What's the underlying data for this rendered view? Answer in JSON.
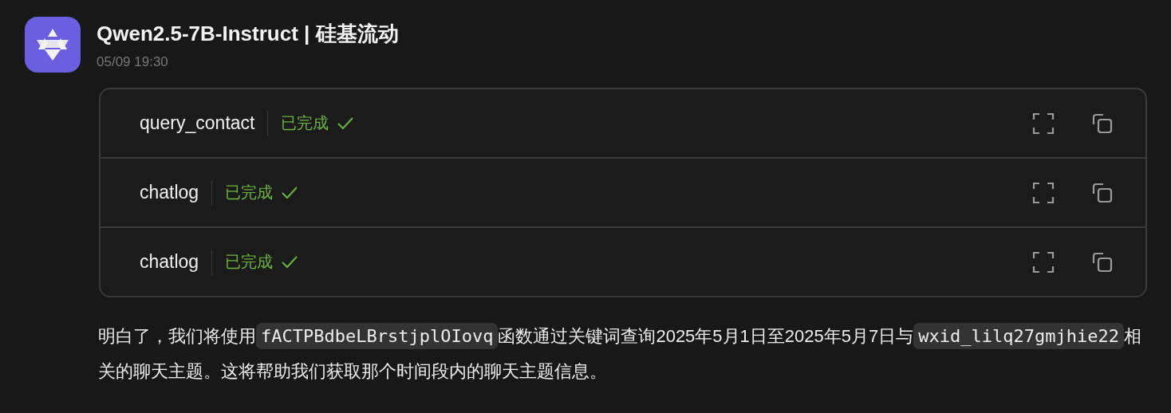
{
  "message": {
    "sender": "Qwen2.5-7B-Instruct | 硅基流动",
    "time": "05/09 19:30",
    "tool_calls": [
      {
        "name": "query_contact",
        "status": "已完成",
        "done": true
      },
      {
        "name": "chatlog",
        "status": "已完成",
        "done": true
      },
      {
        "name": "chatlog",
        "status": "已完成",
        "done": true
      }
    ],
    "paragraph": [
      {
        "kind": "text",
        "text": "明白了，我们将使用"
      },
      {
        "kind": "code",
        "text": "fACTPBdbeLBrstjplOIovq"
      },
      {
        "kind": "text",
        "text": "函数通过关键词查询2025年5月1日至2025年5月7日与"
      },
      {
        "kind": "code",
        "text": "wxid_lilq27gmjhie22"
      },
      {
        "kind": "text",
        "text": "相关的聊天主题。这将帮助我们获取那个时间段内的聊天主题信息。"
      }
    ]
  }
}
